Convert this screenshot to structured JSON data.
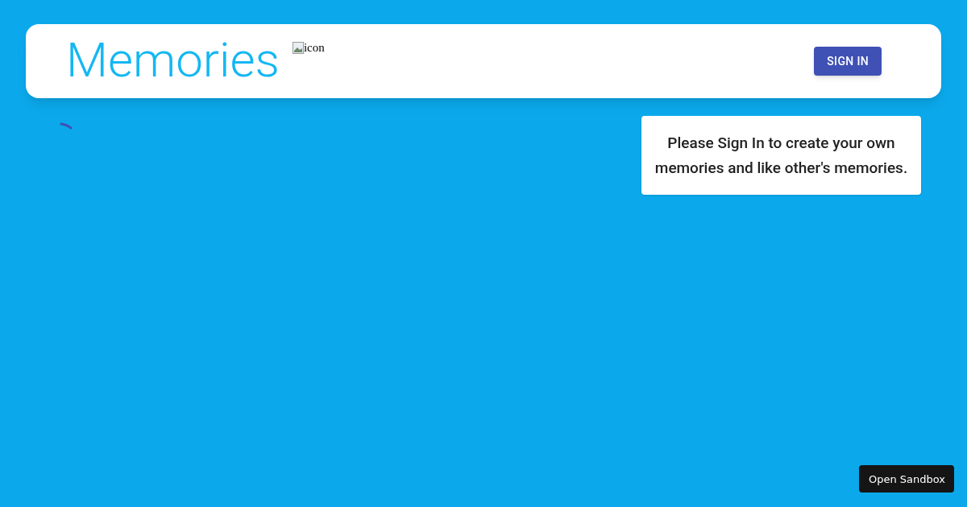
{
  "app_bar": {
    "title": "Memories",
    "logo_alt": "icon",
    "sign_in_button": "SIGN IN"
  },
  "notice": {
    "text": "Please Sign In to create your own memories and like other's memories."
  },
  "sandbox_button": {
    "label": "Open Sandbox"
  }
}
